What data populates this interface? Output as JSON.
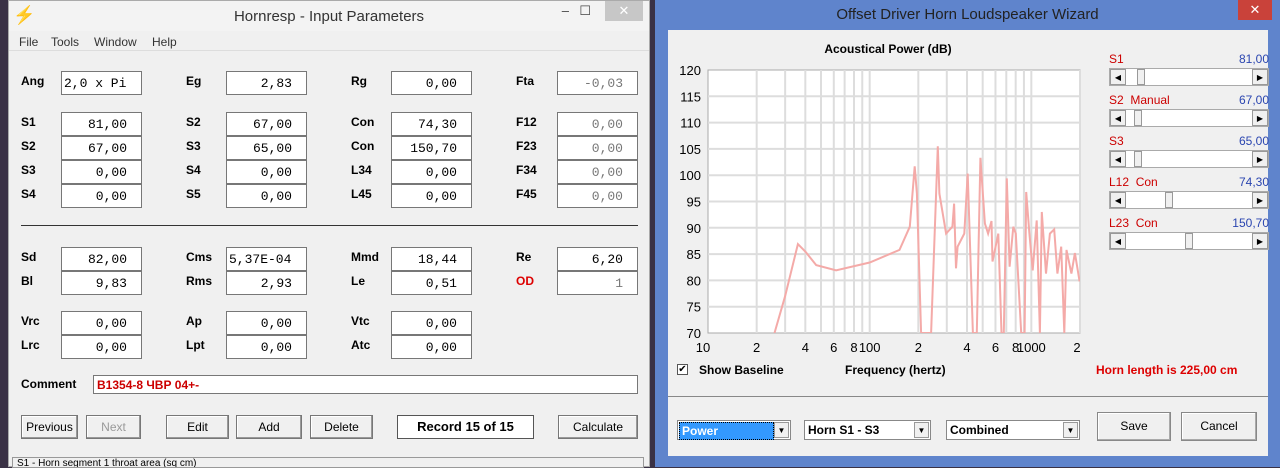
{
  "left_window": {
    "title": "Hornresp - Input Parameters",
    "controls": {
      "minimize": "‒",
      "maximize": "☐",
      "close": "✕"
    },
    "menu": [
      "File",
      "Tools",
      "Window",
      "Help"
    ],
    "fields": [
      {
        "label": "Ang",
        "value": "2,0 x Pi"
      },
      {
        "label": "Eg",
        "value": "2,83"
      },
      {
        "label": "Rg",
        "value": "0,00"
      },
      {
        "label": "Fta",
        "value": "-0,03"
      },
      {
        "label": "S1",
        "value": "81,00"
      },
      {
        "label": "S2",
        "value": "67,00"
      },
      {
        "label": "Con",
        "value": "74,30"
      },
      {
        "label": "F12",
        "value": "0,00"
      },
      {
        "label": "S2",
        "value": "67,00"
      },
      {
        "label": "S3",
        "value": "65,00"
      },
      {
        "label": "Con",
        "value": "150,70"
      },
      {
        "label": "F23",
        "value": "0,00"
      },
      {
        "label": "S3",
        "value": "0,00"
      },
      {
        "label": "S4",
        "value": "0,00"
      },
      {
        "label": "L34",
        "value": "0,00"
      },
      {
        "label": "F34",
        "value": "0,00"
      },
      {
        "label": "S4",
        "value": "0,00"
      },
      {
        "label": "S5",
        "value": "0,00"
      },
      {
        "label": "L45",
        "value": "0,00"
      },
      {
        "label": "F45",
        "value": "0,00"
      },
      {
        "label": "Sd",
        "value": "82,00"
      },
      {
        "label": "Cms",
        "value": "5,37E-04"
      },
      {
        "label": "Mmd",
        "value": "18,44"
      },
      {
        "label": "Re",
        "value": "6,20"
      },
      {
        "label": "Bl",
        "value": "9,83"
      },
      {
        "label": "Rms",
        "value": "2,93"
      },
      {
        "label": "Le",
        "value": "0,51"
      },
      {
        "label": "OD",
        "value": "1"
      },
      {
        "label": "Vrc",
        "value": "0,00"
      },
      {
        "label": "Ap",
        "value": "0,00"
      },
      {
        "label": "Vtc",
        "value": "0,00"
      },
      {
        "label": "Lrc",
        "value": "0,00"
      },
      {
        "label": "Lpt",
        "value": "0,00"
      },
      {
        "label": "Atc",
        "value": "0,00"
      }
    ],
    "comment_label": "Comment",
    "comment_value": "B1354-8 ЧВР 04+-",
    "buttons": {
      "previous": "Previous",
      "next": "Next",
      "edit": "Edit",
      "add": "Add",
      "delete": "Delete",
      "calculate": "Calculate"
    },
    "record": "Record 15 of 15",
    "status": "S1 - Horn segment 1 throat area (sq cm)"
  },
  "wizard": {
    "title": "Offset Driver Horn Loudspeaker Wizard",
    "close": "✕",
    "sliders": [
      {
        "label": "S1",
        "value": "81,00",
        "position": 0.09
      },
      {
        "label": "S2  Manual",
        "value": "67,00",
        "position": 0.07
      },
      {
        "label": "S3",
        "value": "65,00",
        "position": 0.07
      },
      {
        "label": "L12  Con",
        "value": "74,30",
        "position": 0.33
      },
      {
        "label": "L23  Con",
        "value": "150,70",
        "position": 0.5
      }
    ],
    "show_baseline": {
      "label": "Show Baseline",
      "checked": true
    },
    "horn_length": "Horn length is 225,00 cm",
    "dropdowns": {
      "type": "Power",
      "horn": "Horn S1 - S3",
      "mode": "Combined"
    },
    "buttons": {
      "save": "Save",
      "cancel": "Cancel"
    }
  },
  "chart_data": {
    "type": "line",
    "title": "Acoustical Power (dB)",
    "xlabel": "Frequency (hertz)",
    "ylabel": "",
    "xscale": "log",
    "xlim": [
      10,
      2000
    ],
    "ylim": [
      70,
      120
    ],
    "yticks": [
      "70",
      "75",
      "80",
      "85",
      "90",
      "95",
      "100",
      "105",
      "110",
      "115",
      "120"
    ],
    "xticks": [
      {
        "v": 10,
        "t": "10"
      },
      {
        "v": 20,
        "t": "2"
      },
      {
        "v": 40,
        "t": "4"
      },
      {
        "v": 60,
        "t": "6"
      },
      {
        "v": 80,
        "t": "8"
      },
      {
        "v": 100,
        "t": "100"
      },
      {
        "v": 200,
        "t": "2"
      },
      {
        "v": 400,
        "t": "4"
      },
      {
        "v": 600,
        "t": "6"
      },
      {
        "v": 800,
        "t": "8"
      },
      {
        "v": 1000,
        "t": "1000"
      },
      {
        "v": 2000,
        "t": "2"
      }
    ],
    "grid": true,
    "color": "#f4aaa8",
    "series": [
      {
        "name": "Power",
        "points": [
          [
            25.8,
            70
          ],
          [
            30,
            77
          ],
          [
            36,
            86.9
          ],
          [
            40,
            85.5
          ],
          [
            46.7,
            82.9
          ],
          [
            62,
            81.9
          ],
          [
            100,
            83.4
          ],
          [
            153,
            85.8
          ],
          [
            177,
            90.2
          ],
          [
            190,
            101.7
          ],
          [
            196,
            96.5
          ],
          [
            208,
            70
          ],
          [
            240,
            70
          ],
          [
            264,
            105.5
          ],
          [
            270,
            96.5
          ],
          [
            297,
            88.9
          ],
          [
            325,
            90.2
          ],
          [
            333,
            94.6
          ],
          [
            342,
            82.3
          ],
          [
            350,
            86.4
          ],
          [
            385,
            88.9
          ],
          [
            404,
            100.3
          ],
          [
            435,
            70
          ],
          [
            460,
            70
          ],
          [
            484,
            103.3
          ],
          [
            516,
            90.8
          ],
          [
            540,
            88.9
          ],
          [
            567,
            91.3
          ],
          [
            575,
            83.6
          ],
          [
            625,
            88.9
          ],
          [
            654,
            70
          ],
          [
            676,
            70
          ],
          [
            705,
            99.4
          ],
          [
            734,
            82.6
          ],
          [
            773,
            90.2
          ],
          [
            802,
            88.9
          ],
          [
            865,
            70
          ],
          [
            909,
            70
          ],
          [
            930,
            96.8
          ],
          [
            973,
            88.9
          ],
          [
            1020,
            81.9
          ],
          [
            1080,
            91.4
          ],
          [
            1130,
            70
          ],
          [
            1160,
            93
          ],
          [
            1232,
            81.3
          ],
          [
            1303,
            88.9
          ],
          [
            1385,
            89.7
          ],
          [
            1450,
            81.3
          ],
          [
            1530,
            86.4
          ],
          [
            1600,
            70
          ],
          [
            1650,
            85.8
          ],
          [
            1770,
            81.3
          ],
          [
            1860,
            85.2
          ],
          [
            1990,
            79.8
          ]
        ]
      }
    ]
  }
}
